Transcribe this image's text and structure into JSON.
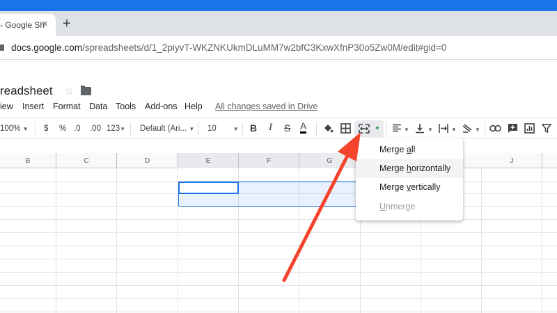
{
  "browser": {
    "tab_title": "- Google Sh",
    "close_glyph": "×",
    "new_tab_glyph": "+",
    "url_host": "docs.google.com",
    "url_path": "/spreadsheets/d/1_2piyvT-WKZNKUkmDLuMM7w2bfC3KxwXfnP30o5Zw0M/edit#gid=0"
  },
  "doc": {
    "title": "readsheet",
    "star_glyph": "☆",
    "menu": [
      "iew",
      "Insert",
      "Format",
      "Data",
      "Tools",
      "Add-ons",
      "Help"
    ],
    "saved_status": "All changes saved in Drive"
  },
  "toolbar": {
    "zoom": "100%",
    "currency": "$",
    "percent": "%",
    "decrease_decimal": ".0",
    "increase_decimal": ".00",
    "more_formats": "123",
    "font": "Default (Ari...",
    "font_size": "10",
    "bold": "B",
    "italic": "I",
    "strike": "S",
    "text_color": "A"
  },
  "grid": {
    "columns": [
      "B",
      "C",
      "D",
      "E",
      "F",
      "G",
      "J"
    ]
  },
  "merge_menu": {
    "items": [
      {
        "pre": "Merge ",
        "key": "a",
        "post": "ll"
      },
      {
        "pre": "Merge ",
        "key": "h",
        "post": "orizontally"
      },
      {
        "pre": "Merge ",
        "key": "v",
        "post": "ertically"
      },
      {
        "pre": "",
        "key": "U",
        "post": "nmerge"
      }
    ]
  },
  "colors": {
    "accent": "#1a73e8",
    "arrow": "#f4442e"
  },
  "icons": [
    "lock-icon",
    "star-icon",
    "folder-icon",
    "paint-format-icon",
    "borders-icon",
    "merge-cells-icon",
    "align-left-icon",
    "valign-bottom-icon",
    "text-wrap-icon",
    "text-rotate-icon",
    "link-icon",
    "comment-icon",
    "chart-icon",
    "filter-icon"
  ]
}
